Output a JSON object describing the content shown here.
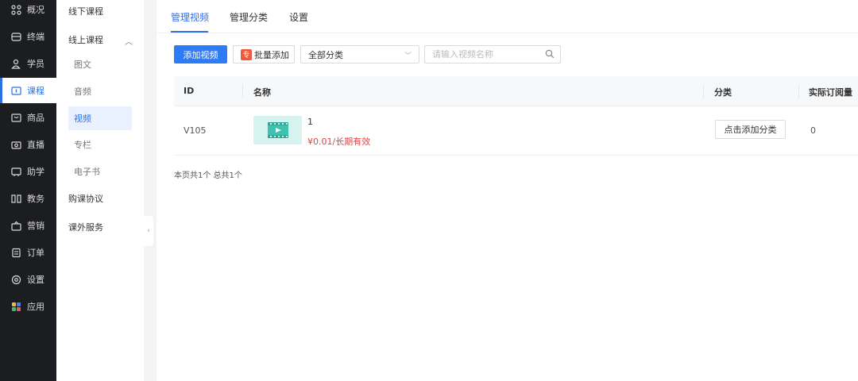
{
  "nav": {
    "items": [
      {
        "label": "概况",
        "icon": "grid-icon"
      },
      {
        "label": "终端",
        "icon": "terminal-icon"
      },
      {
        "label": "学员",
        "icon": "users-icon"
      },
      {
        "label": "课程",
        "icon": "course-icon",
        "active": true
      },
      {
        "label": "商品",
        "icon": "goods-icon"
      },
      {
        "label": "直播",
        "icon": "live-icon"
      },
      {
        "label": "助学",
        "icon": "study-icon"
      },
      {
        "label": "教务",
        "icon": "academic-icon"
      },
      {
        "label": "营销",
        "icon": "marketing-icon"
      },
      {
        "label": "订单",
        "icon": "order-icon"
      },
      {
        "label": "设置",
        "icon": "settings-icon"
      },
      {
        "label": "应用",
        "icon": "apps-icon"
      }
    ],
    "accent": "#2d6fe8",
    "background": "#1c1d21"
  },
  "submenu": {
    "offline": "线下课程",
    "online": "线上课程",
    "children": [
      "图文",
      "音频",
      "视频",
      "专栏",
      "电子书"
    ],
    "active_child": "视频",
    "agreement": "购课协议",
    "extra": "课外服务"
  },
  "tabs": [
    "管理视频",
    "管理分类",
    "设置"
  ],
  "toolbar": {
    "add_label": "添加视频",
    "batch_badge": "专",
    "batch_label": "批量添加",
    "category_select": "全部分类",
    "search_placeholder": "请输入视频名称"
  },
  "table": {
    "headers": [
      "ID",
      "名称",
      "分类",
      "实际订阅量"
    ],
    "rows": [
      {
        "id": "V105",
        "name": "1",
        "price": "¥0.01/长期有效",
        "category_button": "点击添加分类",
        "subscriptions": "0"
      }
    ]
  },
  "footer": "本页共1个 总共1个"
}
